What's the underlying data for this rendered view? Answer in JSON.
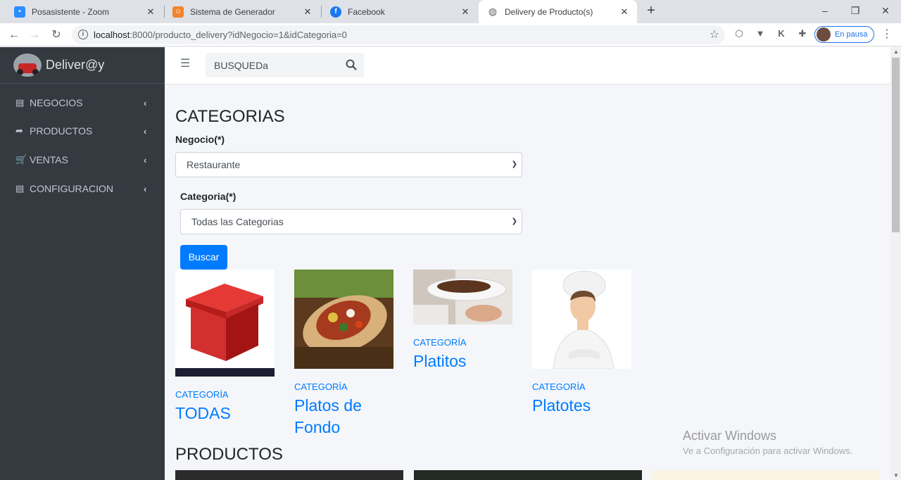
{
  "browser": {
    "tabs": [
      {
        "title": "Posasistente - Zoom",
        "icon": "zoom-icon"
      },
      {
        "title": "Sistema de Generador",
        "icon": "generator-icon"
      },
      {
        "title": "Facebook",
        "icon": "facebook-icon"
      },
      {
        "title": "Delivery de Producto(s)",
        "icon": "globe-icon",
        "active": true
      }
    ],
    "url_host": "localhost",
    "url_rest": ":8000/producto_delivery?idNegocio=1&idCategoria=0",
    "profile_status": "En pausa"
  },
  "sidebar": {
    "brand": "Deliver@y",
    "items": [
      {
        "label": "NEGOCIOS",
        "icon": "list-icon"
      },
      {
        "label": "PRODUCTOS",
        "icon": "share-icon"
      },
      {
        "label": "VENTAS",
        "icon": "cart-icon"
      },
      {
        "label": "CONFIGURACION",
        "icon": "list-icon"
      }
    ]
  },
  "topnav": {
    "search_placeholder": "BUSQUEDa"
  },
  "main": {
    "categories_heading": "CATEGORIAS",
    "negocio_label": "Negocio(*)",
    "negocio_value": "Restaurante",
    "categoria_label": "Categoria(*)",
    "categoria_value": "Todas las Categorias",
    "search_button": "Buscar",
    "category_cards": [
      {
        "kicker": "CATEGORÍA",
        "title": "TODAS",
        "image": "red-box"
      },
      {
        "kicker": "CATEGORÍA",
        "title": "Platos de Fondo",
        "image": "burrito"
      },
      {
        "kicker": "CATEGORÍA",
        "title": "Platitos",
        "image": "plate"
      },
      {
        "kicker": "CATEGORÍA",
        "title": "Platotes",
        "image": "chef"
      }
    ],
    "products_heading": "PRODUCTOS"
  },
  "watermark": {
    "title": "Activar Windows",
    "subtitle": "Ve a Configuración para activar Windows."
  },
  "colors": {
    "sidebar": "#343a40",
    "accent": "#007bff",
    "content_bg": "#f4f6f9"
  }
}
